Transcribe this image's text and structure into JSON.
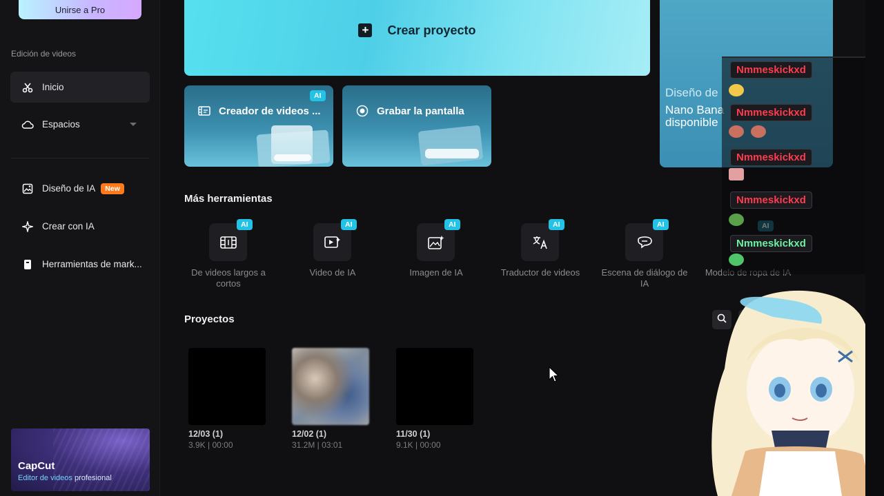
{
  "sidebar": {
    "pro_button": "Unirse a Pro",
    "section_label": "Edición de videos",
    "items": [
      {
        "label": "Inicio",
        "icon": "scissors-icon"
      },
      {
        "label": "Espacios",
        "icon": "cloud-icon"
      },
      {
        "label": "Diseño de IA",
        "icon": "image-edit-icon",
        "badge": "New"
      },
      {
        "label": "Crear con IA",
        "icon": "sparkle-icon"
      },
      {
        "label": "Herramientas de mark...",
        "icon": "marketing-icon"
      }
    ],
    "promo": {
      "title": "CapCut",
      "subtitle_highlight": "Editor de videos",
      "subtitle_rest": " profesional"
    }
  },
  "hero": {
    "label": "Crear proyecto"
  },
  "cards": [
    {
      "label": "Creador de videos ...",
      "badge": "AI"
    },
    {
      "label": "Grabar la pantalla"
    }
  ],
  "right_panel": {
    "line1": "Diseño de",
    "line2a": "Nano Bana",
    "line2b": "disponible"
  },
  "more_tools": {
    "title": "Más herramientas",
    "items": [
      {
        "label": "De videos largos a cortos",
        "badge": "AI",
        "icon": "film-cut-icon"
      },
      {
        "label": "Video de IA",
        "badge": "AI",
        "icon": "video-play-icon"
      },
      {
        "label": "Imagen de IA",
        "badge": "AI",
        "icon": "image-sparkle-icon"
      },
      {
        "label": "Traductor de videos",
        "badge": "AI",
        "icon": "translate-icon"
      },
      {
        "label": "Escena de diálogo de IA",
        "badge": "AI",
        "icon": "dialog-icon"
      },
      {
        "label": "Modelo de ropa de IA",
        "badge": "AI",
        "icon": "clothing-icon"
      }
    ]
  },
  "projects": {
    "title": "Proyectos",
    "items": [
      {
        "name": "12/03 (1)",
        "meta": "3.9K | 00:00"
      },
      {
        "name": "12/02 (1)",
        "meta": "31.2M | 03:01"
      },
      {
        "name": "11/30 (1)",
        "meta": "9.1K | 00:00"
      }
    ]
  },
  "chat": {
    "messages": [
      {
        "user": "Nmmeskickxd"
      },
      {
        "user": "Nmmeskickxd"
      },
      {
        "user": "Nmmeskickxd"
      },
      {
        "user": "Nmmeskickxd"
      },
      {
        "user": "Nmmeskickxd"
      }
    ]
  },
  "colors": {
    "accent": "#22c3e6",
    "new_badge": "#ff7a1a",
    "chat_red": "#ff3b4e",
    "chat_green": "#6ff0a2"
  }
}
